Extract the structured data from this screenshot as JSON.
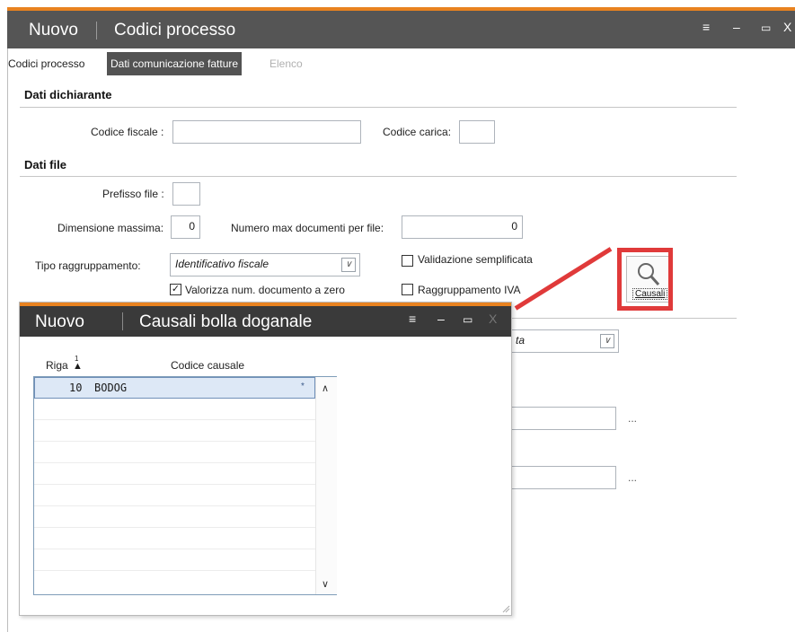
{
  "main_window": {
    "mode": "Nuovo",
    "title": "Codici processo",
    "controls": {
      "menu": "≡",
      "minimize": "–",
      "maximize": "▭",
      "close": "X"
    }
  },
  "tabs": [
    {
      "label": "Codici processo",
      "state": "normal"
    },
    {
      "label": "Dati comunicazione fatture",
      "state": "active"
    },
    {
      "label": "Elenco",
      "state": "disabled"
    }
  ],
  "dati_dichiarante": {
    "heading": "Dati dichiarante",
    "codice_fiscale_label": "Codice fiscale :",
    "codice_fiscale_value": "",
    "codice_carica_label": "Codice carica:",
    "codice_carica_value": ""
  },
  "dati_file": {
    "heading": "Dati file",
    "prefisso_label": "Prefisso file :",
    "prefisso_value": "",
    "dimensione_label": "Dimensione massima:",
    "dimensione_value": "0",
    "numero_max_label": "Numero max documenti per file:",
    "numero_max_value": "0",
    "tipo_label": "Tipo raggruppamento:",
    "tipo_value": "Identificativo fiscale",
    "validazione_label": "Validazione semplificata",
    "validazione_checked": false,
    "valorizza_label": "Valorizza num. documento a zero",
    "valorizza_checked": true,
    "raggruppamento_label": "Raggruppamento IVA",
    "raggruppamento_checked": false,
    "causali_button_label": "Causali",
    "partial_combo_text": "ta",
    "ellipsis": "..."
  },
  "popup": {
    "mode": "Nuovo",
    "title": "Causali bolla doganale",
    "controls": {
      "menu": "≡",
      "minimize": "–",
      "maximize": "▭",
      "close": "X"
    },
    "columns": {
      "riga": "Riga",
      "sort_marker": "1",
      "codice": "Codice causale"
    },
    "rows": [
      {
        "riga": "10",
        "codice": "BODOG"
      }
    ],
    "row_marker": "*"
  },
  "colors": {
    "accent": "#e8821f",
    "highlight": "#e03a3a",
    "titlebar": "#555555",
    "popup_titlebar": "#3a3a3a"
  }
}
